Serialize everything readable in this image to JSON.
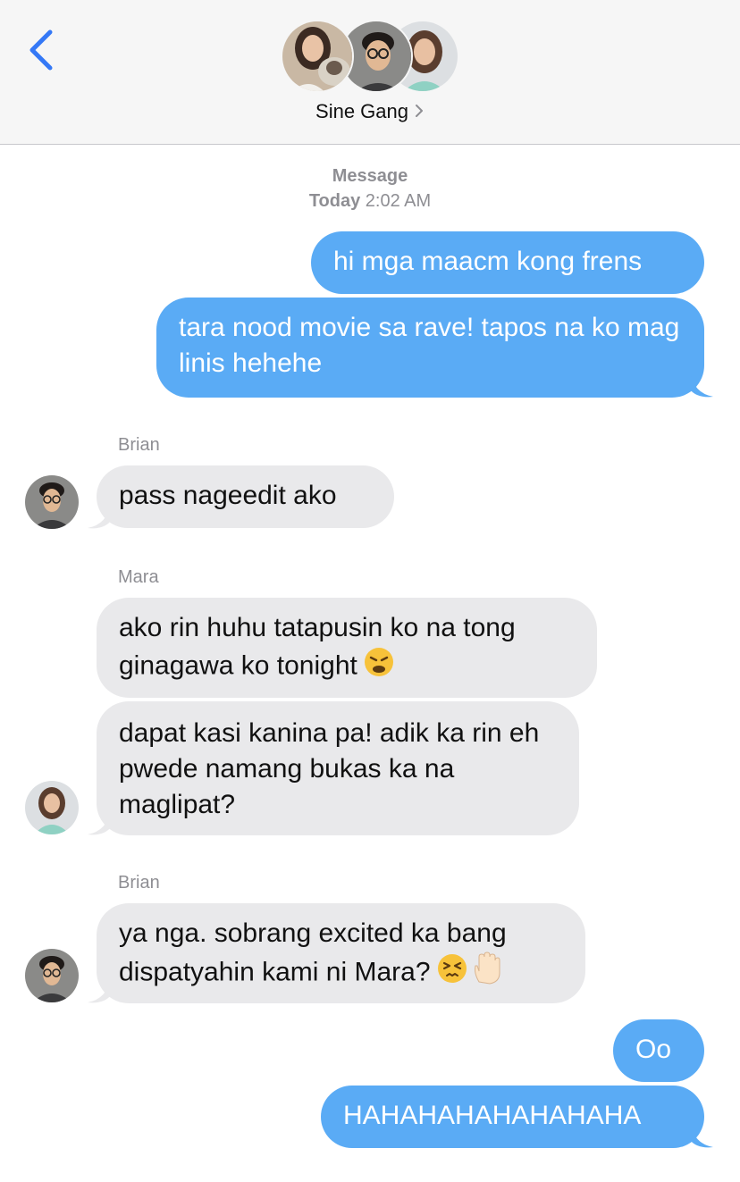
{
  "header": {
    "back_icon": "chevron-left-icon",
    "group_name": "Sine Gang",
    "chevron_icon": "chevron-right-icon",
    "accent_color": "#3478f6"
  },
  "timestamp": {
    "service": "Message",
    "day": "Today",
    "time": "2:02 AM"
  },
  "messages": [
    {
      "direction": "outgoing",
      "text": "hi mga maacm kong frens"
    },
    {
      "direction": "outgoing",
      "text": "tara nood movie sa rave! tapos na ko mag linis hehehe"
    },
    {
      "direction": "incoming",
      "sender": "Brian",
      "text": "pass nageedit ako"
    },
    {
      "direction": "incoming",
      "sender": "Mara",
      "text": "ako rin huhu tatapusin ko na tong ginagawa ko tonight",
      "emoji": "weary-face-icon"
    },
    {
      "direction": "incoming",
      "text": "dapat kasi kanina pa! adik ka rin eh pwede namang bukas ka na maglipat?"
    },
    {
      "direction": "incoming",
      "sender": "Brian",
      "text": "ya nga. sobrang excited ka bang dispatyahin kami ni Mara?",
      "emoji": [
        "persevering-face-icon",
        "raised-hand-icon"
      ]
    },
    {
      "direction": "outgoing",
      "text": "Oo"
    },
    {
      "direction": "outgoing",
      "text": "HAHAHAHAHAHAHAHA"
    }
  ],
  "colors": {
    "outgoing_bubble": "#5aabf5",
    "incoming_bubble": "#e9e9eb",
    "meta_text": "#8e8e93"
  }
}
